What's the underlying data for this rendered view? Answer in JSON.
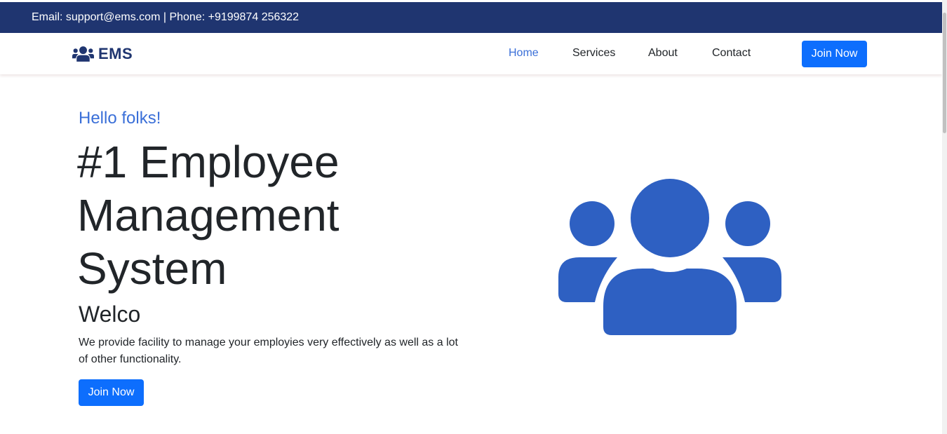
{
  "topbar": {
    "contact_text": "Email: support@ems.com | Phone: +9199874 256322"
  },
  "navbar": {
    "brand_icon": "users-icon",
    "brand": "EMS",
    "links": [
      {
        "label": "Home",
        "active": true
      },
      {
        "label": "Services",
        "active": false
      },
      {
        "label": "About",
        "active": false
      },
      {
        "label": "Contact",
        "active": false
      }
    ],
    "join_label": "Join Now"
  },
  "hero": {
    "greeting": "Hello folks!",
    "title_lines": [
      "#1 Employee",
      "Management",
      "System"
    ],
    "subtitle": "Welco",
    "description": "We provide facility to manage your employies very effectively as well as a lot of other functionality.",
    "join_label": "Join Now",
    "illustration_icon": "users-icon"
  },
  "colors": {
    "topbar_bg": "#1f3570",
    "accent": "#3a6fd8",
    "button": "#0d6efd",
    "illustration": "#2e60c2"
  }
}
